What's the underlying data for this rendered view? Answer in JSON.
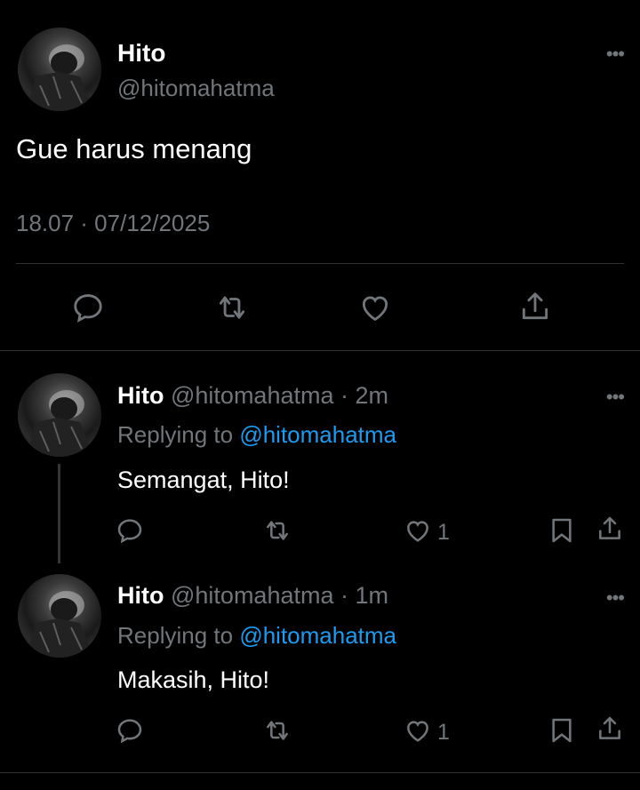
{
  "main_tweet": {
    "name": "Hito",
    "handle": "@hitomahatma",
    "text": "Gue harus menang",
    "timestamp": "18.07 · 07/12/2025",
    "more_icon": "ellipsis-icon",
    "actions": [
      "reply-icon",
      "retweet-icon",
      "like-icon",
      "share-icon"
    ]
  },
  "replies": [
    {
      "name": "Hito",
      "handle": "@hitomahatma",
      "separator": "·",
      "time": "2m",
      "replying_label": "Replying to",
      "replying_to": "@hitomahatma",
      "text": "Semangat, Hito!",
      "like_count": "1"
    },
    {
      "name": "Hito",
      "handle": "@hitomahatma",
      "separator": "·",
      "time": "1m",
      "replying_label": "Replying to",
      "replying_to": "@hitomahatma",
      "text": "Makasih, Hito!",
      "like_count": "1"
    }
  ],
  "colors": {
    "background": "#000000",
    "text": "#ffffff",
    "muted": "#71767b",
    "link": "#1d9bf0",
    "divider": "#2f3336"
  }
}
